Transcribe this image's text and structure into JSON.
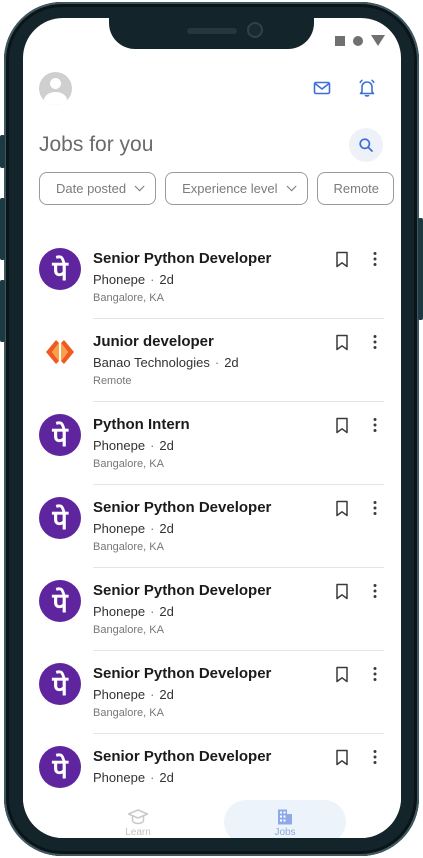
{
  "header": {
    "title": "Jobs for you"
  },
  "filters": [
    {
      "label": "Date posted",
      "has_chevron": true
    },
    {
      "label": "Experience level",
      "has_chevron": true
    },
    {
      "label": "Remote",
      "has_chevron": false
    }
  ],
  "jobs": [
    {
      "title": "Senior Python Developer",
      "company": "Phonepe",
      "posted": "2d",
      "location": "Bangalore, KA",
      "logo": "phonepe-logo",
      "logo_text": "पे"
    },
    {
      "title": "Junior developer",
      "company": "Banao Technologies",
      "posted": "2d",
      "location": "Remote",
      "logo": "banao-logo",
      "logo_text": ""
    },
    {
      "title": "Python Intern",
      "company": "Phonepe",
      "posted": "2d",
      "location": "Bangalore, KA",
      "logo": "phonepe-logo",
      "logo_text": "पे"
    },
    {
      "title": "Senior Python Developer",
      "company": "Phonepe",
      "posted": "2d",
      "location": "Bangalore, KA",
      "logo": "phonepe-logo",
      "logo_text": "पे"
    },
    {
      "title": "Senior Python Developer",
      "company": "Phonepe",
      "posted": "2d",
      "location": "Bangalore, KA",
      "logo": "phonepe-logo",
      "logo_text": "पे"
    },
    {
      "title": "Senior Python Developer",
      "company": "Phonepe",
      "posted": "2d",
      "location": "Bangalore, KA",
      "logo": "phonepe-logo",
      "logo_text": "पे"
    },
    {
      "title": "Senior Python Developer",
      "company": "Phonepe",
      "posted": "2d",
      "location": "",
      "logo": "phonepe-logo",
      "logo_text": "पे"
    }
  ],
  "bottom_nav": [
    {
      "label": "Learn",
      "icon": "graduation-cap-icon",
      "active": false
    },
    {
      "label": "Jobs",
      "icon": "building-icon",
      "active": true
    }
  ],
  "colors": {
    "brand_purple": "#5f259f",
    "accent_blue": "#3d6fd8",
    "nav_active_bg": "#edf3fb",
    "banao_orange": "#f05a22"
  }
}
